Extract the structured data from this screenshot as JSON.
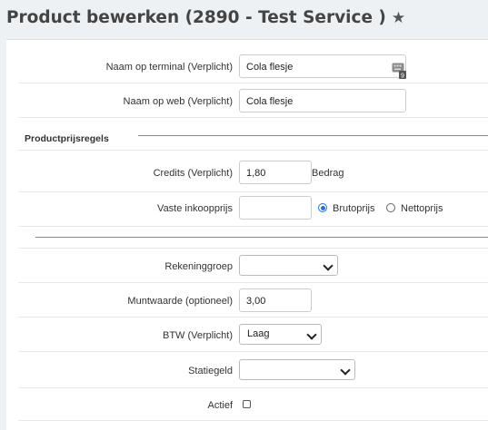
{
  "header": {
    "title": "Product bewerken (2890 - Test Service )",
    "favorite_icon": "star-icon"
  },
  "form": {
    "name_terminal": {
      "label": "Naam op terminal (Verplicht)",
      "value": "Cola flesje",
      "icon": "keyboard-icon",
      "icon_badge": "9"
    },
    "name_web": {
      "label": "Naam op web (Verplicht)",
      "value": "Cola flesje"
    },
    "section_pricing": "Productprijsregels",
    "credits": {
      "label": "Credits (Verplicht)",
      "value": "1,80",
      "suffix": "Bedrag"
    },
    "purchase_price": {
      "label": "Vaste inkoopprijs",
      "value": "",
      "options": [
        {
          "label": "Brutoprijs",
          "selected": true
        },
        {
          "label": "Nettoprijs",
          "selected": false
        }
      ]
    },
    "account_group": {
      "label": "Rekeninggroep",
      "value": ""
    },
    "coin_value": {
      "label": "Muntwaarde (optioneel)",
      "value": "3,00"
    },
    "vat": {
      "label": "BTW (Verplicht)",
      "value": "Laag"
    },
    "deposit": {
      "label": "Statiegeld",
      "value": ""
    },
    "active": {
      "label": "Actief",
      "checked": false
    }
  },
  "colors": {
    "accent": "#1a73e8",
    "background": "#eef1f4",
    "panel": "#ffffff"
  }
}
